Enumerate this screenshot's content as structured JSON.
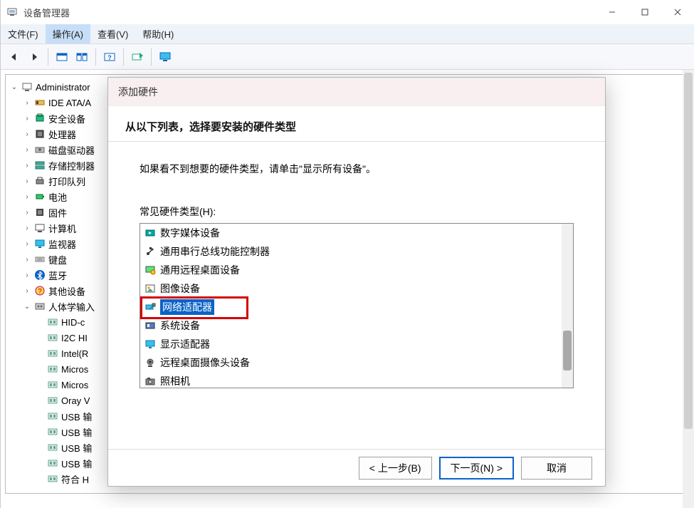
{
  "window": {
    "title": "设备管理器",
    "controls": {
      "min": "–",
      "max": "▢",
      "close": "✕"
    }
  },
  "menubar": {
    "items": [
      {
        "label": "文件(F)"
      },
      {
        "label": "操作(A)",
        "active": true
      },
      {
        "label": "查看(V)"
      },
      {
        "label": "帮助(H)"
      }
    ]
  },
  "toolbar": {
    "buttons": [
      {
        "name": "back"
      },
      {
        "name": "forward"
      },
      {
        "name": "group1-a"
      },
      {
        "name": "group1-b"
      },
      {
        "name": "help"
      },
      {
        "name": "scan"
      },
      {
        "name": "monitor"
      }
    ]
  },
  "tree": {
    "root": "Administrator",
    "children": [
      {
        "label": "IDE ATA/A",
        "icon": "ide"
      },
      {
        "label": "安全设备",
        "icon": "security"
      },
      {
        "label": "处理器",
        "icon": "cpu"
      },
      {
        "label": "磁盘驱动器",
        "icon": "disk"
      },
      {
        "label": "存储控制器",
        "icon": "storage"
      },
      {
        "label": "打印队列",
        "icon": "printer"
      },
      {
        "label": "电池",
        "icon": "battery"
      },
      {
        "label": "固件",
        "icon": "firmware"
      },
      {
        "label": "计算机",
        "icon": "computer"
      },
      {
        "label": "监视器",
        "icon": "monitor"
      },
      {
        "label": "键盘",
        "icon": "keyboard"
      },
      {
        "label": "蓝牙",
        "icon": "bluetooth"
      },
      {
        "label": "其他设备",
        "icon": "other"
      },
      {
        "label": "人体学输入",
        "icon": "hid",
        "expanded": true,
        "children": [
          {
            "label": "HID-c",
            "icon": "hid-dev"
          },
          {
            "label": "I2C HI",
            "icon": "hid-dev"
          },
          {
            "label": "Intel(R",
            "icon": "hid-dev"
          },
          {
            "label": "Micros",
            "icon": "hid-dev"
          },
          {
            "label": "Micros",
            "icon": "hid-dev"
          },
          {
            "label": "Oray V",
            "icon": "hid-dev"
          },
          {
            "label": "USB 输",
            "icon": "hid-dev"
          },
          {
            "label": "USB 输",
            "icon": "hid-dev"
          },
          {
            "label": "USB 输",
            "icon": "hid-dev"
          },
          {
            "label": "USB 输",
            "icon": "hid-dev"
          },
          {
            "label": "符合 H",
            "icon": "hid-dev"
          }
        ]
      }
    ]
  },
  "dialog": {
    "title": "添加硬件",
    "heading": "从以下列表，选择要安装的硬件类型",
    "hint": "如果看不到想要的硬件类型，请单击\"显示所有设备\"。",
    "list_label": "常见硬件类型(H):",
    "items": [
      {
        "label": "数字媒体设备",
        "icon": "media"
      },
      {
        "label": "通用串行总线功能控制器",
        "icon": "usb"
      },
      {
        "label": "通用远程桌面设备",
        "icon": "remote"
      },
      {
        "label": "图像设备",
        "icon": "image"
      },
      {
        "label": "网络适配器",
        "icon": "network",
        "selected": true
      },
      {
        "label": "系统设备",
        "icon": "system"
      },
      {
        "label": "显示适配器",
        "icon": "display"
      },
      {
        "label": "远程桌面摄像头设备",
        "icon": "webcam"
      },
      {
        "label": "照相机",
        "icon": "camera"
      }
    ],
    "buttons": {
      "back": "< 上一步(B)",
      "next": "下一页(N) >",
      "cancel": "取消"
    }
  }
}
